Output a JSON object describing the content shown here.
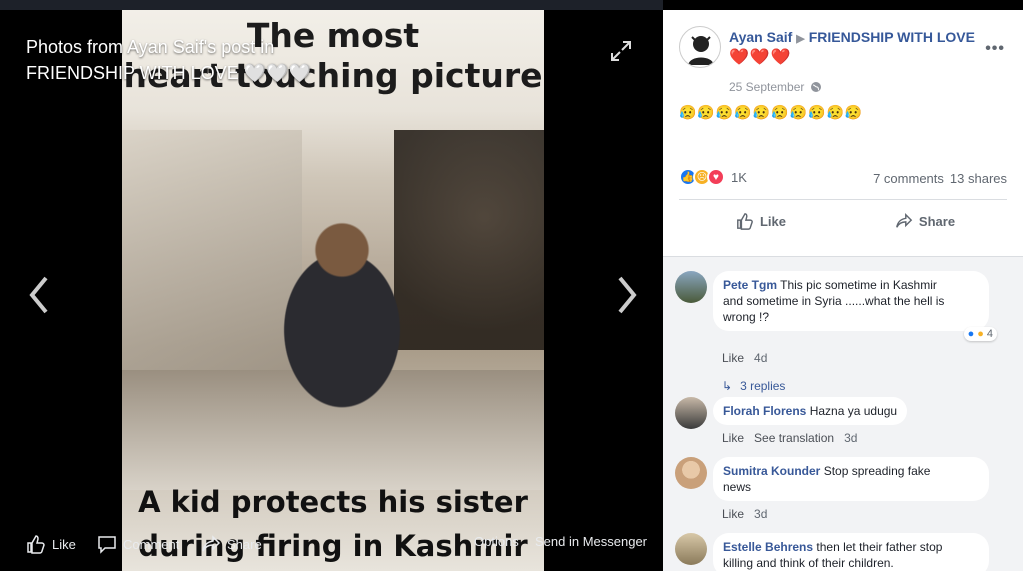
{
  "viewer": {
    "title": "Photos from Ayan Saif's post in FRIENDSHIP WITH LOVE 🤍🤍🤍",
    "photo": {
      "caption_top_line1": "The most",
      "caption_top_line2": "heart touching picture",
      "caption_bottom_line1": "A kid protects his sister",
      "caption_bottom_line2": "during firing in Kashmir"
    },
    "actions": {
      "like": "Like",
      "comment": "Comment",
      "share": "Share",
      "options": "Options",
      "send": "Send in Messenger"
    }
  },
  "post": {
    "author": "Ayan Saif",
    "group": "FRIENDSHIP WITH LOVE",
    "hearts": "❤️❤️❤️",
    "date": "25 September",
    "text": "😥😥😥😥😥😥😥😥😥😥",
    "reaction_count": "1K",
    "comments_count": "7 comments",
    "shares_count": "13 shares",
    "like_label": "Like",
    "share_label": "Share"
  },
  "comments": [
    {
      "name": "Pete Tgm",
      "text_line1": "This pic sometime in Kashmir",
      "text_line2": "and sometime in Syria ......what the hell is",
      "text_line3": "wrong !?",
      "reaction_count": "4",
      "like": "Like",
      "time": "4d",
      "replies": "3 replies"
    },
    {
      "name": "Florah Florens",
      "text_line1": "Hazna ya udugu",
      "like": "Like",
      "translate": "See translation",
      "time": "3d"
    },
    {
      "name": "Sumitra Kounder",
      "text_line1": "Stop spreading fake",
      "text_line2": "news",
      "like": "Like",
      "time": "3d"
    },
    {
      "name": "Estelle Behrens",
      "text_line1": "then let their father stop",
      "text_line2": "killing and think of their children."
    }
  ],
  "colors": {
    "link_blue": "#365899",
    "like_blue": "#1877f2",
    "love_red": "#f33e58",
    "sad_yellow": "#f7b125"
  }
}
